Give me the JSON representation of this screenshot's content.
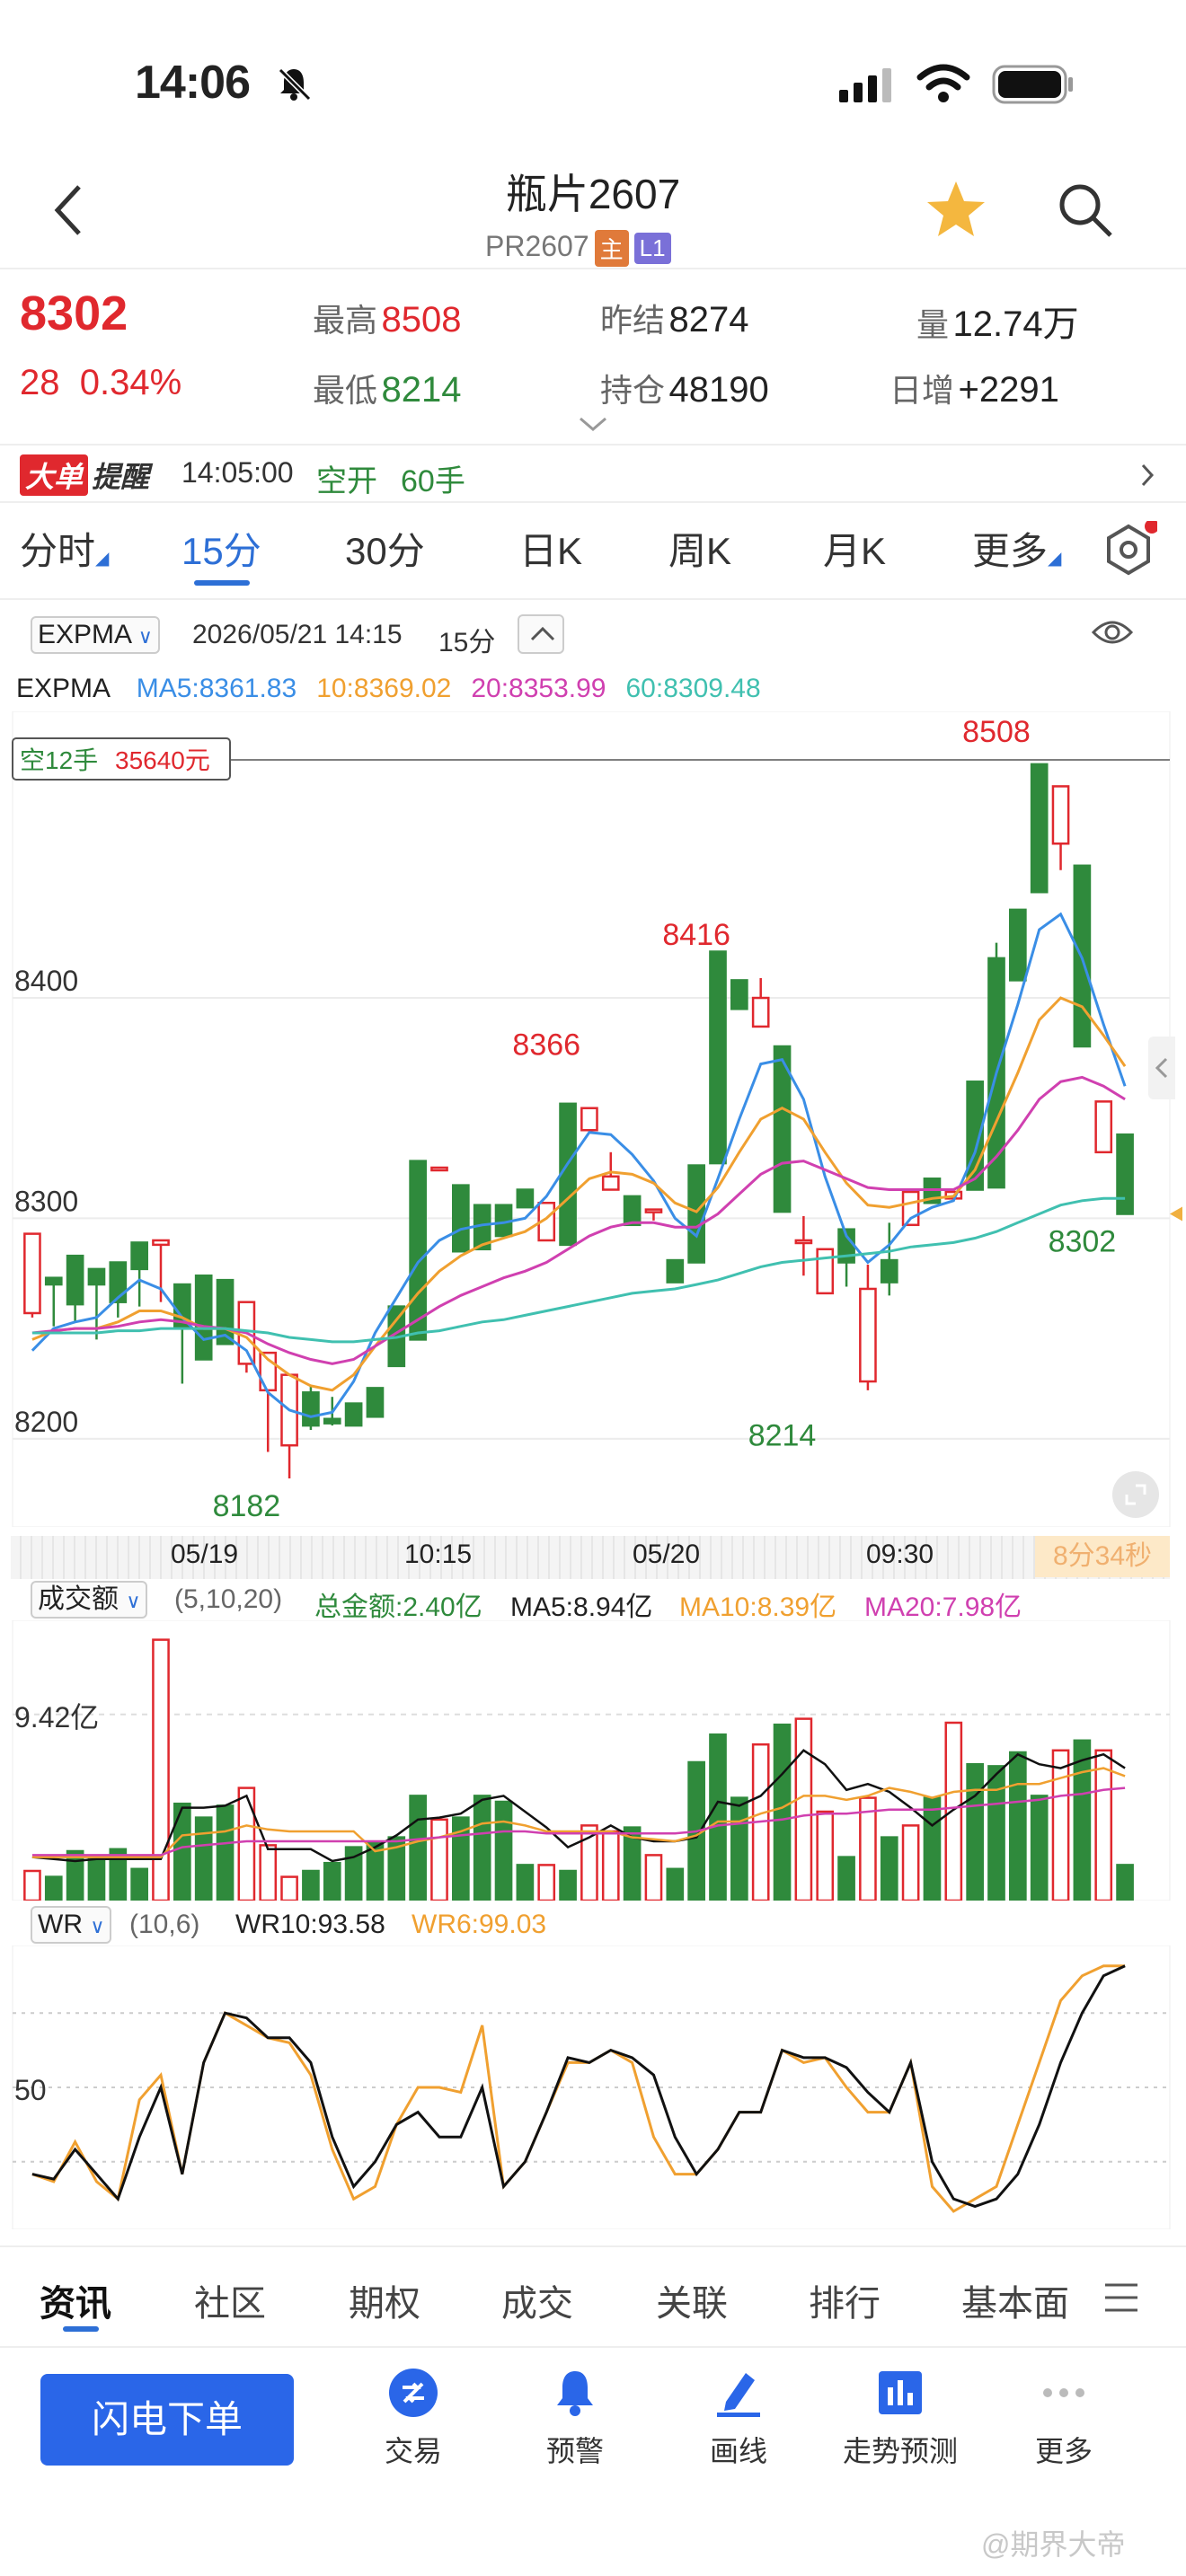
{
  "status": {
    "time": "14:06"
  },
  "nav": {
    "title": "瓶片2607",
    "code": "PR2607",
    "tag_main": "主",
    "tag_l1": "L1"
  },
  "quote": {
    "last": "8302",
    "change": "28",
    "change_pct": "0.34%",
    "high_label": "最高",
    "high": "8508",
    "low_label": "最低",
    "low": "8214",
    "prev_label": "昨结",
    "prev": "8274",
    "oi_label": "持仓",
    "oi": "48190",
    "vol_label": "量",
    "vol": "12.74万",
    "inc_label": "日增",
    "inc": "+2291"
  },
  "alert": {
    "badge1": "大单",
    "badge2": "提醒",
    "time": "14:05:00",
    "type": "空开",
    "qty": "60手"
  },
  "tabs": [
    "分时",
    "15分",
    "30分",
    "日K",
    "周K",
    "月K",
    "更多"
  ],
  "active_tab": 1,
  "main_chart": {
    "indicator": "EXPMA",
    "datetime": "2026/05/21 14:15",
    "period": "15分",
    "ma_labels": [
      {
        "text": "MA5:8361.83",
        "color": "#3a8ee6"
      },
      {
        "text": "10:8369.02",
        "color": "#f0a030"
      },
      {
        "text": "20:8353.99",
        "color": "#d040b0"
      },
      {
        "text": "60:8309.48",
        "color": "#40c0b0"
      }
    ],
    "position_label": "空12手",
    "position_value": "35640元",
    "x_labels": [
      "05/19",
      "10:15",
      "05/20",
      "09:30"
    ],
    "countdown": "8分34秒"
  },
  "volume_panel": {
    "indicator": "成交额",
    "params": "(5,10,20)",
    "total": "总金额:2.40亿",
    "ma5": "MA5:8.94亿",
    "ma10": "MA10:8.39亿",
    "ma20": "MA20:7.98亿",
    "axis_label": "9.42亿"
  },
  "wr_panel": {
    "indicator": "WR",
    "params": "(10,6)",
    "wr10": "WR10:93.58",
    "wr6": "WR6:99.03",
    "axis_label": "50"
  },
  "bottom_tabs": [
    "资讯",
    "社区",
    "期权",
    "成交",
    "关联",
    "排行",
    "基本面"
  ],
  "actions": {
    "flash": "闪电下单",
    "trade": "交易",
    "alert": "预警",
    "draw": "画线",
    "forecast": "走势预测",
    "more": "更多"
  },
  "watermark": "@期界大帝",
  "chart_data": {
    "type": "candlestick",
    "y_ticks": [
      8200,
      8300,
      8400
    ],
    "ylim": [
      8160,
      8530
    ],
    "annotations": [
      {
        "text": "8182",
        "value": 8182,
        "index": 10
      },
      {
        "text": "8366",
        "value": 8366,
        "index": 24
      },
      {
        "text": "8416",
        "value": 8416,
        "index": 31
      },
      {
        "text": "8214",
        "value": 8214,
        "index": 35
      },
      {
        "text": "8508",
        "value": 8508,
        "index": 45
      },
      {
        "text": "8302",
        "value": 8302,
        "index": 49
      }
    ],
    "candles": [
      [
        8257,
        8293,
        8255,
        8255
      ],
      [
        8273,
        8270,
        8251,
        8256
      ],
      [
        8283,
        8261,
        8253,
        8279
      ],
      [
        8277,
        8270,
        8245,
        8248
      ],
      [
        8280,
        8262,
        8255,
        8277
      ],
      [
        8289,
        8277,
        8260,
        8286
      ],
      [
        8288,
        8290,
        8262,
        8272
      ],
      [
        8270,
        8250,
        8225,
        8238
      ],
      [
        8274,
        8236,
        8253,
        8237
      ],
      [
        8272,
        8243,
        8270,
        8262
      ],
      [
        8234,
        8262,
        8230,
        8244
      ],
      [
        8222,
        8239,
        8194,
        8234
      ],
      [
        8197,
        8229,
        8182,
        8214
      ],
      [
        8221,
        8206,
        8204,
        8224
      ],
      [
        8209,
        8207,
        8206,
        8219
      ],
      [
        8216,
        8206,
        8212,
        8214
      ],
      [
        8223,
        8210,
        8252,
        8210
      ],
      [
        8260,
        8233,
        8257,
        8260
      ],
      [
        8326,
        8245,
        8336,
        8245
      ],
      [
        8323,
        8323,
        8333,
        8315
      ],
      [
        8315,
        8285,
        8326,
        8285
      ],
      [
        8306,
        8286,
        8298,
        8289
      ],
      [
        8306,
        8292,
        8313,
        8292
      ],
      [
        8313,
        8305,
        8322,
        8300
      ],
      [
        8290,
        8307,
        8313,
        8303
      ],
      [
        8352,
        8288,
        8366,
        8282
      ],
      [
        8340,
        8350,
        8345,
        8336
      ],
      [
        8313,
        8319,
        8337,
        8330
      ],
      [
        8310,
        8297,
        8310,
        8300
      ],
      [
        8303,
        8304,
        8299,
        8303
      ],
      [
        8281,
        8271,
        8279,
        8260
      ],
      [
        8324,
        8280,
        8325,
        8282
      ],
      [
        8421,
        8325,
        8416,
        8323
      ],
      [
        8408,
        8395,
        8413,
        8399
      ],
      [
        8387,
        8400,
        8404,
        8409
      ],
      [
        8378,
        8303,
        8370,
        8304
      ],
      [
        8290,
        8290,
        8274,
        8301
      ],
      [
        8266,
        8286,
        8276,
        8221
      ],
      [
        8295,
        8280,
        8269,
        8271
      ],
      [
        8226,
        8268,
        8222,
        8279
      ],
      [
        8281,
        8271,
        8265,
        8298
      ],
      [
        8297,
        8312,
        8306,
        8282
      ],
      [
        8318,
        8307,
        8322,
        8303
      ],
      [
        8309,
        8312,
        8316,
        8313
      ],
      [
        8362,
        8313,
        8313,
        8362
      ],
      [
        8418,
        8314,
        8355,
        8425
      ],
      [
        8440,
        8408,
        8408,
        8433
      ],
      [
        8506,
        8448,
        8508,
        8497
      ],
      [
        8470,
        8496,
        8458,
        8470
      ],
      [
        8460,
        8378,
        8426,
        8370
      ],
      [
        8330,
        8353,
        8336,
        8341
      ],
      [
        8338,
        8302,
        8302,
        8338
      ]
    ],
    "series": [
      {
        "name": "MA5",
        "color": "#3a8ee6",
        "values": [
          8240,
          8250,
          8253,
          8255,
          8264,
          8272,
          8268,
          8255,
          8245,
          8247,
          8240,
          8221,
          8213,
          8210,
          8212,
          8226,
          8248,
          8264,
          8280,
          8290,
          8295,
          8297,
          8298,
          8300,
          8310,
          8325,
          8339,
          8338,
          8329,
          8317,
          8300,
          8292,
          8318,
          8345,
          8370,
          8372,
          8354,
          8319,
          8292,
          8280,
          8288,
          8300,
          8305,
          8308,
          8330,
          8366,
          8397,
          8431,
          8438,
          8418,
          8388,
          8360
        ]
      },
      {
        "name": "10",
        "color": "#f0a030",
        "values": [
          8245,
          8249,
          8250,
          8250,
          8253,
          8258,
          8258,
          8255,
          8250,
          8250,
          8246,
          8236,
          8229,
          8224,
          8222,
          8229,
          8242,
          8254,
          8266,
          8276,
          8283,
          8288,
          8291,
          8294,
          8300,
          8309,
          8318,
          8321,
          8320,
          8316,
          8307,
          8303,
          8314,
          8330,
          8345,
          8350,
          8345,
          8330,
          8316,
          8306,
          8305,
          8307,
          8309,
          8310,
          8322,
          8344,
          8366,
          8390,
          8400,
          8396,
          8383,
          8369
        ]
      },
      {
        "name": "20",
        "color": "#d040b0",
        "values": [
          8248,
          8249,
          8250,
          8250,
          8251,
          8253,
          8254,
          8253,
          8251,
          8250,
          8248,
          8243,
          8239,
          8236,
          8234,
          8236,
          8242,
          8248,
          8254,
          8260,
          8265,
          8269,
          8273,
          8276,
          8280,
          8286,
          8292,
          8296,
          8298,
          8298,
          8296,
          8296,
          8302,
          8311,
          8320,
          8325,
          8326,
          8322,
          8318,
          8314,
          8313,
          8313,
          8313,
          8313,
          8318,
          8328,
          8340,
          8354,
          8362,
          8364,
          8360,
          8354
        ]
      },
      {
        "name": "60",
        "color": "#40c0b0",
        "values": [
          8248,
          8248,
          8248,
          8248,
          8249,
          8249,
          8250,
          8250,
          8250,
          8250,
          8249,
          8248,
          8246,
          8245,
          8244,
          8244,
          8245,
          8246,
          8248,
          8249,
          8251,
          8253,
          8254,
          8256,
          8258,
          8260,
          8262,
          8264,
          8266,
          8267,
          8268,
          8270,
          8272,
          8275,
          8278,
          8280,
          8281,
          8282,
          8283,
          8284,
          8285,
          8287,
          8288,
          8289,
          8291,
          8294,
          8298,
          8302,
          8306,
          8308,
          8309,
          8309
        ]
      }
    ],
    "volume": {
      "ylim": [
        0,
        14
      ],
      "tick": 9.42,
      "values": [
        1.5,
        1.2,
        2.5,
        2.2,
        2.6,
        1.6,
        13.2,
        4.9,
        4.2,
        4.8,
        5.7,
        2.8,
        1.2,
        1.5,
        1.9,
        2.7,
        2.9,
        3.2,
        5.3,
        4.1,
        4.2,
        5.3,
        5.0,
        1.8,
        1.8,
        1.5,
        3.8,
        3.5,
        3.7,
        2.3,
        1.6,
        7.0,
        8.4,
        5.2,
        7.9,
        8.9,
        9.2,
        4.5,
        2.2,
        5.2,
        3.2,
        3.8,
        5.2,
        9.0,
        6.9,
        6.8,
        7.5,
        5.3,
        7.6,
        8.1,
        7.6,
        1.8
      ],
      "ma5": [
        2.2,
        2.1,
        2.0,
        2.1,
        2.1,
        2.1,
        2.1,
        4.7,
        4.7,
        4.8,
        5.3,
        2.6,
        2.6,
        2.6,
        2.0,
        2.2,
        2.7,
        3.3,
        4.1,
        4.2,
        4.4,
        5.1,
        5.3,
        4.5,
        3.7,
        2.7,
        3.2,
        3.8,
        3.2,
        3.0,
        3.0,
        3.2,
        5.0,
        4.8,
        5.3,
        6.4,
        7.6,
        6.9,
        5.6,
        5.9,
        5.5,
        4.7,
        3.8,
        4.6,
        5.3,
        6.4,
        7.4,
        6.9,
        6.7,
        7.1,
        7.4,
        6.7
      ],
      "ma10": [
        2.2,
        2.2,
        2.2,
        2.2,
        2.2,
        2.2,
        2.2,
        3.3,
        3.4,
        3.5,
        3.8,
        3.6,
        3.5,
        3.5,
        3.5,
        3.5,
        2.5,
        2.7,
        3.0,
        3.2,
        3.5,
        3.9,
        4.0,
        3.8,
        3.5,
        3.5,
        3.5,
        3.5,
        3.2,
        3.1,
        3.0,
        3.3,
        4.0,
        4.0,
        4.4,
        4.7,
        5.3,
        5.3,
        5.1,
        5.3,
        5.7,
        5.5,
        5.2,
        5.5,
        5.6,
        5.6,
        5.9,
        5.9,
        6.2,
        6.5,
        6.7,
        6.3
      ],
      "ma20": [
        2.3,
        2.3,
        2.3,
        2.3,
        2.3,
        2.3,
        2.3,
        2.7,
        2.8,
        2.9,
        3.0,
        3.0,
        3.0,
        3.0,
        3.0,
        3.0,
        3.0,
        3.0,
        3.1,
        3.2,
        3.3,
        3.4,
        3.5,
        3.5,
        3.4,
        3.4,
        3.4,
        3.4,
        3.4,
        3.4,
        3.4,
        3.5,
        3.8,
        3.9,
        4.0,
        4.1,
        4.3,
        4.4,
        4.4,
        4.5,
        4.6,
        4.6,
        4.6,
        4.7,
        4.8,
        4.9,
        5.0,
        5.1,
        5.3,
        5.4,
        5.6,
        5.7
      ]
    },
    "wr": {
      "wr10": [
        15,
        13,
        25,
        15,
        5,
        30,
        50,
        15,
        60,
        80,
        78,
        70,
        70,
        60,
        30,
        10,
        20,
        35,
        40,
        30,
        30,
        50,
        10,
        20,
        40,
        62,
        60,
        65,
        62,
        55,
        30,
        15,
        25,
        40,
        40,
        65,
        62,
        62,
        58,
        48,
        40,
        60,
        20,
        5,
        2,
        5,
        15,
        35,
        60,
        80,
        95,
        99
      ],
      "wr6": [
        15,
        12,
        28,
        12,
        5,
        45,
        55,
        15,
        60,
        80,
        75,
        70,
        68,
        55,
        25,
        5,
        10,
        35,
        50,
        50,
        48,
        75,
        10,
        20,
        40,
        60,
        60,
        65,
        60,
        30,
        15,
        15,
        25,
        40,
        40,
        65,
        60,
        62,
        50,
        40,
        40,
        60,
        10,
        0,
        5,
        10,
        35,
        60,
        85,
        95,
        99,
        99
      ]
    }
  }
}
